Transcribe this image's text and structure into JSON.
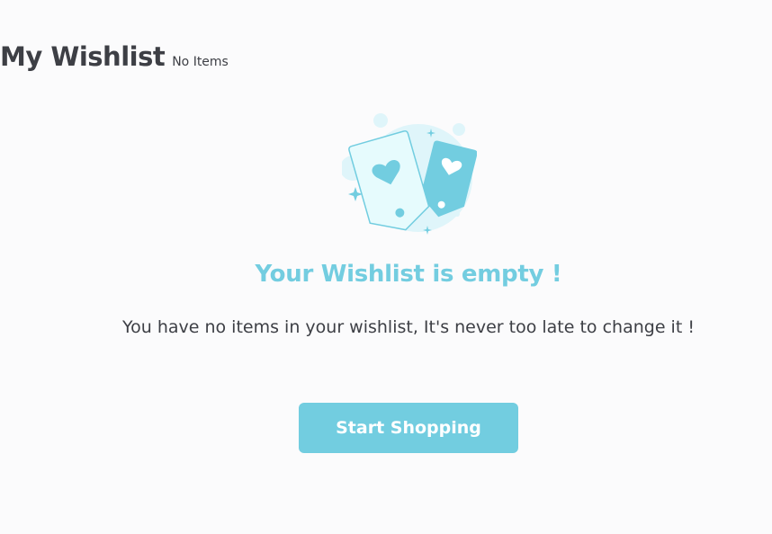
{
  "header": {
    "title": "My Wishlist",
    "count": "No Items"
  },
  "empty_state": {
    "illustration_icon": "wishlist-cards-heart-icon",
    "title": "Your Wishlist is empty !",
    "message": "You have no items in your wishlist, It's never too late to change it !",
    "button_label": "Start Shopping"
  },
  "colors": {
    "accent": "#72cde0",
    "text": "#3d3f45",
    "background": "#fbfbfc"
  }
}
